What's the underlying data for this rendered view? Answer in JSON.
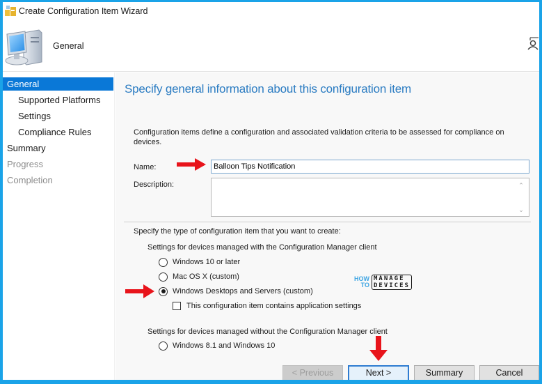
{
  "window": {
    "title": "Create Configuration Item Wizard",
    "header_title": "General",
    "icons": {
      "title": "wizard-app-icon",
      "header": "computer-icon",
      "header_right": "user-icon"
    }
  },
  "sidebar": {
    "items": [
      {
        "label": "General",
        "state": "active",
        "level": 0
      },
      {
        "label": "Supported Platforms",
        "state": "normal",
        "level": 1
      },
      {
        "label": "Settings",
        "state": "normal",
        "level": 1
      },
      {
        "label": "Compliance Rules",
        "state": "normal",
        "level": 1
      },
      {
        "label": "Summary",
        "state": "normal",
        "level": 0
      },
      {
        "label": "Progress",
        "state": "disabled",
        "level": 0
      },
      {
        "label": "Completion",
        "state": "disabled",
        "level": 0
      }
    ]
  },
  "main": {
    "title": "Specify general information about this configuration item",
    "description": "Configuration items define a configuration and associated validation criteria to be assessed for compliance on devices.",
    "name_label": "Name:",
    "name_value": "Balloon Tips Notification",
    "description_label": "Description:",
    "description_value": "",
    "type_prompt": "Specify the type of configuration item that you want to create:",
    "group_with_client": "Settings for devices managed with the Configuration Manager client",
    "options_with_client": [
      {
        "label": "Windows 10 or later",
        "checked": false
      },
      {
        "label": "Mac OS X (custom)",
        "checked": false
      },
      {
        "label": "Windows Desktops and Servers (custom)",
        "checked": true
      }
    ],
    "app_settings_checkbox": {
      "label": "This configuration item contains application settings",
      "checked": false
    },
    "group_without_client": "Settings for devices managed without the Configuration Manager client",
    "options_without_client": [
      {
        "label": "Windows 8.1 and Windows 10",
        "checked": false
      }
    ]
  },
  "buttons": {
    "previous": "< Previous",
    "next": "Next >",
    "summary": "Summary",
    "cancel": "Cancel"
  },
  "watermark": {
    "how": "HOW",
    "to": "TO",
    "manage": "MANAGE",
    "devices": "DEVICES"
  },
  "colors": {
    "accent": "#0a78d7",
    "title_blue": "#2b7cc2",
    "frame": "#1aa3e8",
    "annotation_arrow": "#e8141b"
  }
}
